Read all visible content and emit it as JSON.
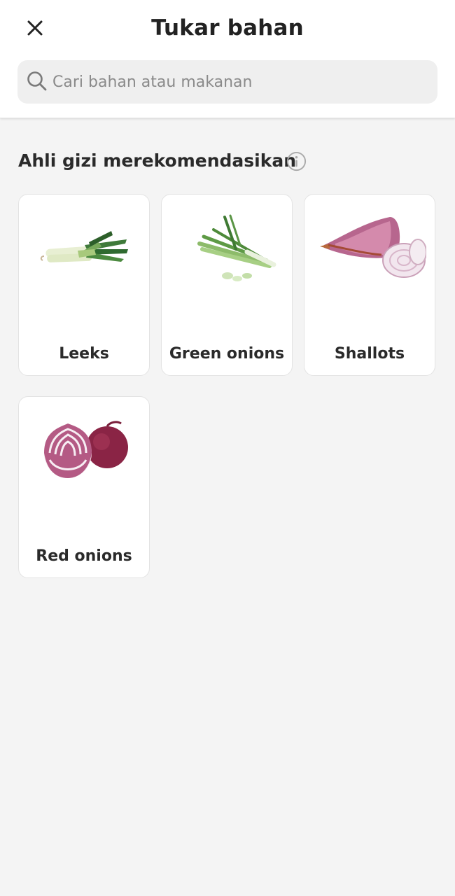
{
  "header": {
    "title": "Tukar bahan",
    "close_icon": "close-icon"
  },
  "search": {
    "placeholder": "Cari bahan atau makanan",
    "value": "",
    "icon": "search-icon"
  },
  "section": {
    "title": "Ahli gizi merekomendasikan",
    "info_icon": "info-icon"
  },
  "items": [
    {
      "label": "Leeks",
      "image": "leeks-image"
    },
    {
      "label": "Green onions",
      "image": "green-onions-image"
    },
    {
      "label": "Shallots",
      "image": "shallots-image"
    },
    {
      "label": "Red onions",
      "image": "red-onions-image"
    }
  ],
  "colors": {
    "background": "#f4f4f4",
    "card": "#ffffff",
    "search_bg": "#efefef",
    "text": "#222222",
    "placeholder": "#8a8a8a"
  }
}
